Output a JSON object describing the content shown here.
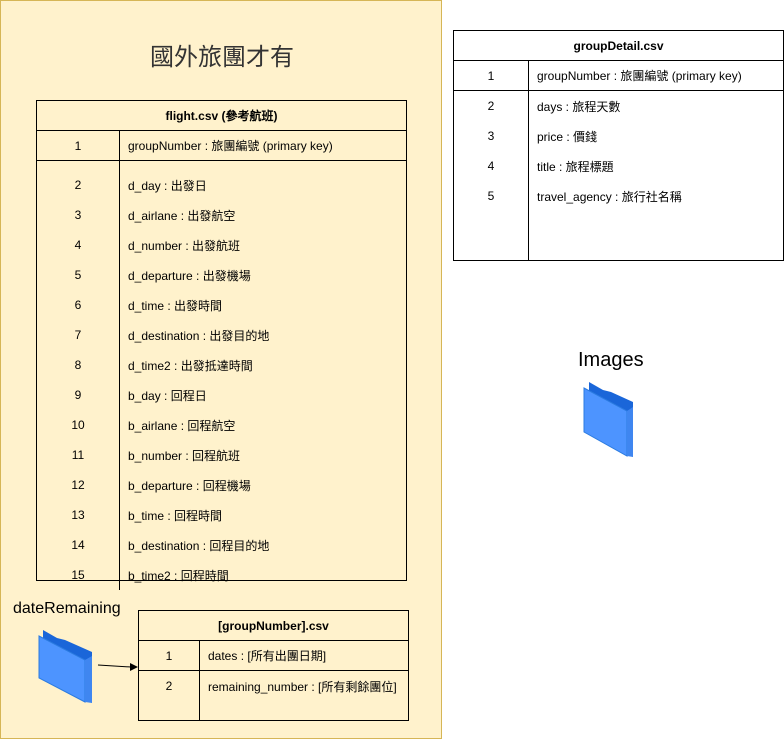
{
  "panel": {
    "title": "國外旅團才有"
  },
  "flight_table": {
    "title": "flight.csv (參考航班)",
    "rows": [
      {
        "num": "1",
        "text": "groupNumber : 旅團編號 (primary key)"
      },
      {
        "num": "2",
        "text": "d_day : 出發日"
      },
      {
        "num": "3",
        "text": "d_airlane : 出發航空"
      },
      {
        "num": "4",
        "text": "d_number : 出發航班"
      },
      {
        "num": "5",
        "text": "d_departure : 出發機場"
      },
      {
        "num": "6",
        "text": "d_time : 出發時間"
      },
      {
        "num": "7",
        "text": "d_destination : 出發目的地"
      },
      {
        "num": "8",
        "text": "d_time2 : 出發抵達時間"
      },
      {
        "num": "9",
        "text": "b_day : 回程日"
      },
      {
        "num": "10",
        "text": "b_airlane : 回程航空"
      },
      {
        "num": "11",
        "text": "b_number : 回程航班"
      },
      {
        "num": "12",
        "text": "b_departure : 回程機場"
      },
      {
        "num": "13",
        "text": "b_time : 回程時間"
      },
      {
        "num": "14",
        "text": "b_destination : 回程目的地"
      },
      {
        "num": "15",
        "text": "b_time2 : 回程時間"
      }
    ]
  },
  "group_detail_table": {
    "title": "groupDetail.csv",
    "rows": [
      {
        "num": "1",
        "text": "groupNumber : 旅團編號 (primary key)"
      },
      {
        "num": "2",
        "text": "days : 旅程天數"
      },
      {
        "num": "3",
        "text": "price : 價錢"
      },
      {
        "num": "4",
        "text": "title : 旅程標題"
      },
      {
        "num": "5",
        "text": "travel_agency : 旅行社名稱"
      }
    ]
  },
  "group_number_table": {
    "title": "[groupNumber].csv",
    "rows": [
      {
        "num": "1",
        "text": "dates : [所有出團日期]"
      },
      {
        "num": "2",
        "text": "remaining_number : [所有剩餘團位]"
      }
    ]
  },
  "folders": {
    "images": {
      "label": "Images",
      "icon": "folder-icon"
    },
    "date_remaining": {
      "label": "dateRemaining",
      "icon": "folder-icon"
    }
  },
  "colors": {
    "panel_fill": "#fff2cc",
    "panel_border": "#d6b656",
    "folder_front": "#4d94ff",
    "folder_back": "#1a66d9"
  }
}
